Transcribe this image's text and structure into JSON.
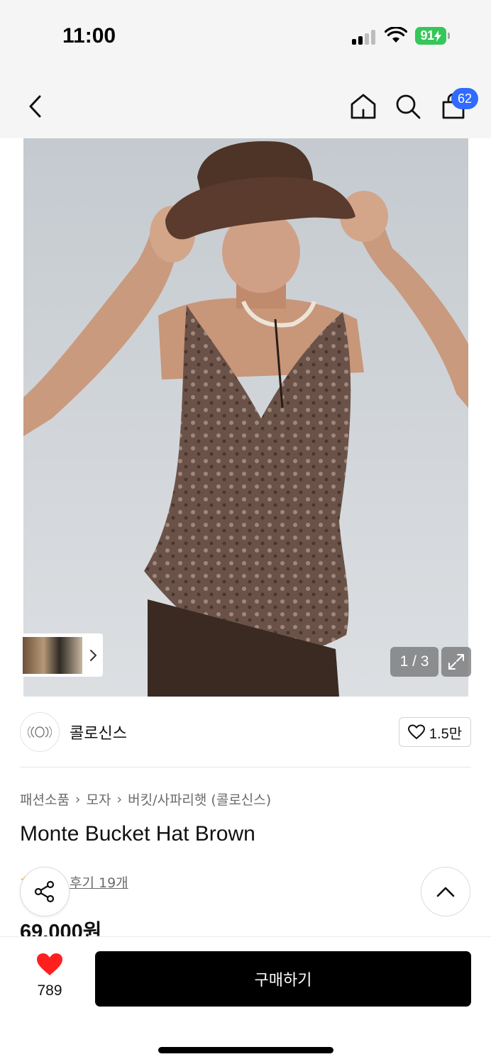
{
  "status_bar": {
    "time": "11:00",
    "battery": "91"
  },
  "nav": {
    "cart_badge": "62",
    "icons": [
      "back-icon",
      "home-icon",
      "search-icon",
      "cart-icon"
    ]
  },
  "gallery": {
    "counter": "1 / 3",
    "current_image": 1,
    "total_images": 3
  },
  "brand": {
    "name": "콜로신스",
    "likes": "1.5만"
  },
  "breadcrumb": [
    "패션소품",
    "모자",
    "버킷/사파리햇 (콜로신스)"
  ],
  "product": {
    "title": "Monte Bucket Hat Brown",
    "reviews_label": "후기 19개",
    "price": "69,000원"
  },
  "bottom_bar": {
    "like_count": "789",
    "buy_label": "구매하기"
  },
  "colors": {
    "cart_badge": "#2f6bff",
    "battery": "#34c759",
    "heart": "#ff1f1f",
    "buy_button": "#000000"
  }
}
